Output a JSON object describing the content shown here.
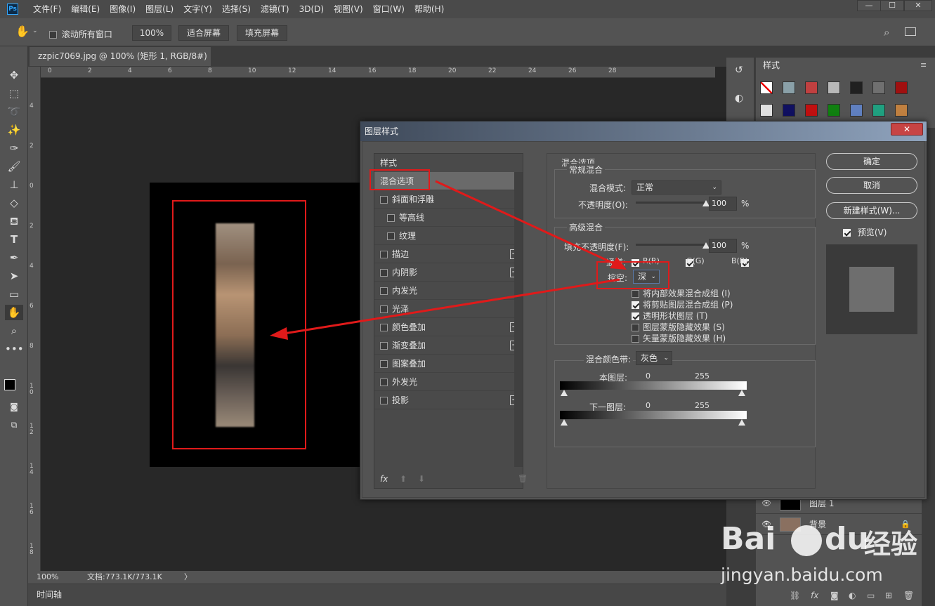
{
  "app": {
    "logo": "Ps",
    "menu": [
      "文件(F)",
      "编辑(E)",
      "图像(I)",
      "图层(L)",
      "文字(Y)",
      "选择(S)",
      "滤镜(T)",
      "3D(D)",
      "视图(V)",
      "窗口(W)",
      "帮助(H)"
    ],
    "window_buttons": [
      "—",
      "☐",
      "✕"
    ]
  },
  "options_bar": {
    "scroll_all_label": "滚动所有窗口",
    "zoom_value": "100%",
    "fit_screen": "适合屏幕",
    "fill_screen": "填充屏幕"
  },
  "document": {
    "tab_title": "zzpic7069.jpg @ 100% (矩形 1, RGB/8#) *",
    "tab_close": "×",
    "ruler_h": [
      "0",
      "2",
      "4",
      "6",
      "8",
      "10",
      "12",
      "14",
      "16",
      "18",
      "20",
      "22",
      "24",
      "26",
      "28"
    ],
    "ruler_v": [
      "4",
      "2",
      "0",
      "2",
      "4",
      "6",
      "8",
      "1 0",
      "1 2",
      "1 4",
      "1 6",
      "1 8"
    ]
  },
  "status": {
    "zoom": "100%",
    "doc_info": "文档:773.1K/773.1K",
    "arrow": "〉"
  },
  "timeline_label": "时间轴",
  "styles_panel": {
    "tab": "样式",
    "swatch_colors": [
      "#ffffff",
      "#8aa0a8",
      "#c04040",
      "#b8b8b8",
      "#202020",
      "#707070",
      "#a01010",
      "#e0e0e0",
      "#101060",
      "#c01010",
      "#108010",
      "#6080c0",
      "#20a080",
      "#c08040"
    ]
  },
  "layers": {
    "rows": [
      {
        "name": "图层 1"
      },
      {
        "name": "背景"
      }
    ],
    "bottom_icons": [
      "link-icon",
      "fx",
      "mask-icon",
      "adjust-icon",
      "folder-icon",
      "new-icon",
      "trash-icon"
    ],
    "fx_label": "fx"
  },
  "dialog": {
    "title": "图层样式",
    "close": "✕",
    "styles_header": "样式",
    "style_items": [
      {
        "label": "混合选项",
        "checkbox": false,
        "plus": false,
        "selected": true
      },
      {
        "label": "斜面和浮雕",
        "checkbox": true,
        "checked": false,
        "plus": false
      },
      {
        "label": "等高线",
        "checkbox": true,
        "checked": false,
        "plus": false,
        "indent": true
      },
      {
        "label": "纹理",
        "checkbox": true,
        "checked": false,
        "plus": false,
        "indent": true
      },
      {
        "label": "描边",
        "checkbox": true,
        "checked": false,
        "plus": true
      },
      {
        "label": "内阴影",
        "checkbox": true,
        "checked": false,
        "plus": true
      },
      {
        "label": "内发光",
        "checkbox": true,
        "checked": false,
        "plus": false
      },
      {
        "label": "光泽",
        "checkbox": true,
        "checked": false,
        "plus": false
      },
      {
        "label": "颜色叠加",
        "checkbox": true,
        "checked": false,
        "plus": true
      },
      {
        "label": "渐变叠加",
        "checkbox": true,
        "checked": false,
        "plus": true
      },
      {
        "label": "图案叠加",
        "checkbox": true,
        "checked": false,
        "plus": false
      },
      {
        "label": "外发光",
        "checkbox": true,
        "checked": false,
        "plus": false
      },
      {
        "label": "投影",
        "checkbox": true,
        "checked": false,
        "plus": true
      }
    ],
    "list_footer": {
      "fx": "fx",
      "up": "⬆",
      "down": "⬇",
      "trash": "🗑"
    },
    "blend": {
      "section_title": "混合选项",
      "general_title": "常规混合",
      "mode_label": "混合模式:",
      "mode_value": "正常",
      "opacity_label": "不透明度(O):",
      "opacity_value": "100",
      "opacity_percent": 100,
      "percent": "%",
      "advanced_title": "高级混合",
      "fill_label": "填充不透明度(F):",
      "fill_value": "100",
      "fill_percent": 100,
      "channels_label": "通道:",
      "channel_r": "R(R)",
      "channel_g": "G(G)",
      "channel_b": "B(B)",
      "knockout_label": "挖空:",
      "knockout_value": "深",
      "options": [
        {
          "label": "将内部效果混合成组 (I)",
          "checked": false
        },
        {
          "label": "将剪贴图层混合成组 (P)",
          "checked": true
        },
        {
          "label": "透明形状图层 (T)",
          "checked": true
        },
        {
          "label": "图层蒙版隐藏效果 (S)",
          "checked": false
        },
        {
          "label": "矢量蒙版隐藏效果 (H)",
          "checked": false
        }
      ],
      "blend_if_label": "混合颜色带:",
      "blend_if_value": "灰色",
      "this_layer_label": "本图层:",
      "this_low": "0",
      "this_high": "255",
      "underlying_label": "下一图层:",
      "under_low": "0",
      "under_high": "255"
    },
    "buttons": {
      "ok": "确定",
      "cancel": "取消",
      "new_style": "新建样式(W)...",
      "preview": "预览(V)"
    }
  },
  "watermark": {
    "brand": "Bai",
    "brand2": "du",
    "cn": "经验",
    "url": "jingyan.baidu.com"
  }
}
